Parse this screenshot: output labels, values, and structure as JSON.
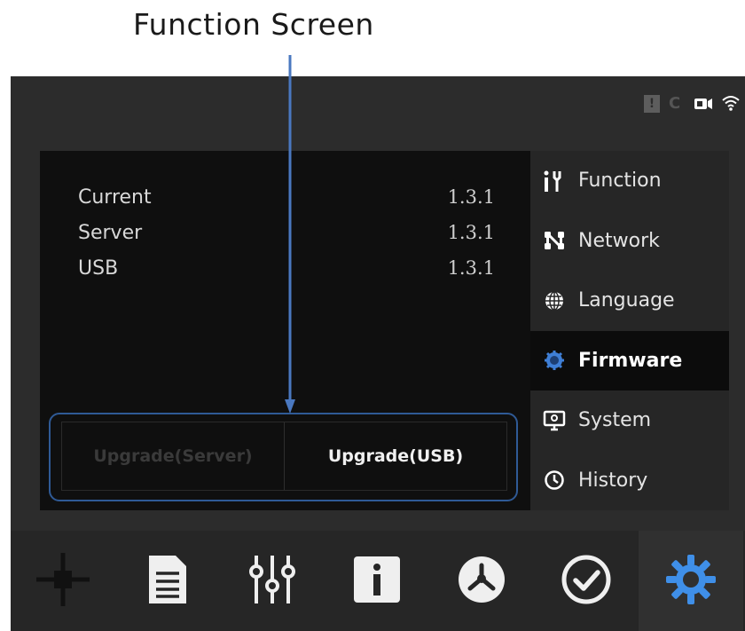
{
  "caption": "Function  Screen",
  "colors": {
    "accent": "#3f7fd6",
    "arrow": "#4a78c0",
    "frame": "#2f5a96",
    "panel": "#0f0f0f",
    "sidebar": "#262626",
    "device": "#2c2c2c"
  },
  "status_icons": [
    "warning-icon",
    "sync-icon",
    "camera-icon",
    "wifi-icon"
  ],
  "versions": [
    {
      "label": "Current",
      "value": "1.3.1"
    },
    {
      "label": "Server",
      "value": "1.3.1"
    },
    {
      "label": "USB",
      "value": "1.3.1"
    }
  ],
  "buttons": {
    "upgrade_server": "Upgrade(Server)",
    "upgrade_usb": "Upgrade(USB)"
  },
  "sidebar": {
    "items": [
      {
        "label": "Function",
        "icon": "tools-icon",
        "active": false
      },
      {
        "label": "Network",
        "icon": "network-icon",
        "active": false
      },
      {
        "label": "Language",
        "icon": "globe-icon",
        "active": false
      },
      {
        "label": "Firmware",
        "icon": "firmware-chip-icon",
        "active": true
      },
      {
        "label": "System",
        "icon": "monitor-icon",
        "active": false
      },
      {
        "label": "History",
        "icon": "clock-icon",
        "active": false
      }
    ]
  },
  "bottom_nav": [
    {
      "icon": "connector-icon",
      "active": false
    },
    {
      "icon": "document-icon",
      "active": false
    },
    {
      "icon": "sliders-icon",
      "active": false
    },
    {
      "icon": "info-icon",
      "active": false
    },
    {
      "icon": "tripod-icon",
      "active": false
    },
    {
      "icon": "check-circle-icon",
      "active": false
    },
    {
      "icon": "settings-gear-icon",
      "active": true
    }
  ]
}
